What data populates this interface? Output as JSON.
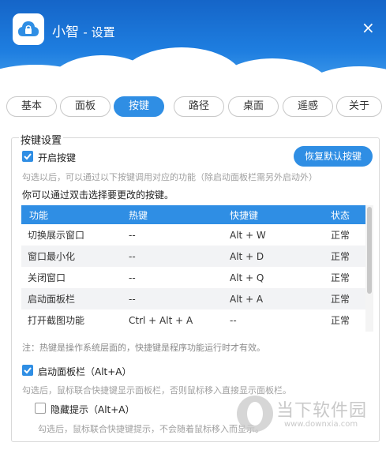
{
  "window": {
    "app_name": "小智",
    "subtitle": "- 设置",
    "close_label": "×"
  },
  "tabs": [
    {
      "label": "基本"
    },
    {
      "label": "面板"
    },
    {
      "label": "按键",
      "active": true
    },
    {
      "label": "路径"
    },
    {
      "label": "桌面"
    },
    {
      "label": "遥感"
    },
    {
      "label": "关于"
    }
  ],
  "hotkey_settings": {
    "group_title": "按键设置",
    "enable_label": "开启按键",
    "enable_checked": true,
    "enable_hint": "勾选以后，可以通过以下按键调用对应的功能（除启动面板栏需另外启动外）",
    "restore_button": "恢复默认按键",
    "instruction": "你可以通过双击选择要更改的按键。",
    "table": {
      "columns": [
        "功能",
        "热键",
        "快捷键",
        "状态"
      ],
      "rows": [
        [
          "切换展示窗口",
          "--",
          "Alt + W",
          "正常"
        ],
        [
          "窗口最小化",
          "--",
          "Alt + D",
          "正常"
        ],
        [
          "关闭窗口",
          "--",
          "Alt + Q",
          "正常"
        ],
        [
          "启动面板栏",
          "--",
          "Alt + A",
          "正常"
        ],
        [
          "打开截图功能",
          "Ctrl + Alt + A",
          "--",
          "正常"
        ]
      ]
    },
    "note": "注：热键是操作系统层面的，快捷键是程序功能运行时才有效。",
    "panel_launch_label": "启动面板栏（Alt+A）",
    "panel_launch_checked": true,
    "panel_launch_hint": "勾选后，鼠标联合快捷键显示面板栏，否则鼠标移入直接显示面板栏。",
    "hide_tip_label": "隐藏提示（Alt+A）",
    "hide_tip_checked": false,
    "hide_tip_hint": "勾选后，鼠标联合快捷键提示，不会随着鼠标移入而显示。"
  },
  "watermark": {
    "text": "当下软件园",
    "url": "www.downxia.com"
  },
  "colors": {
    "accent": "#2f8ee4",
    "header_top": "#1565c8"
  }
}
